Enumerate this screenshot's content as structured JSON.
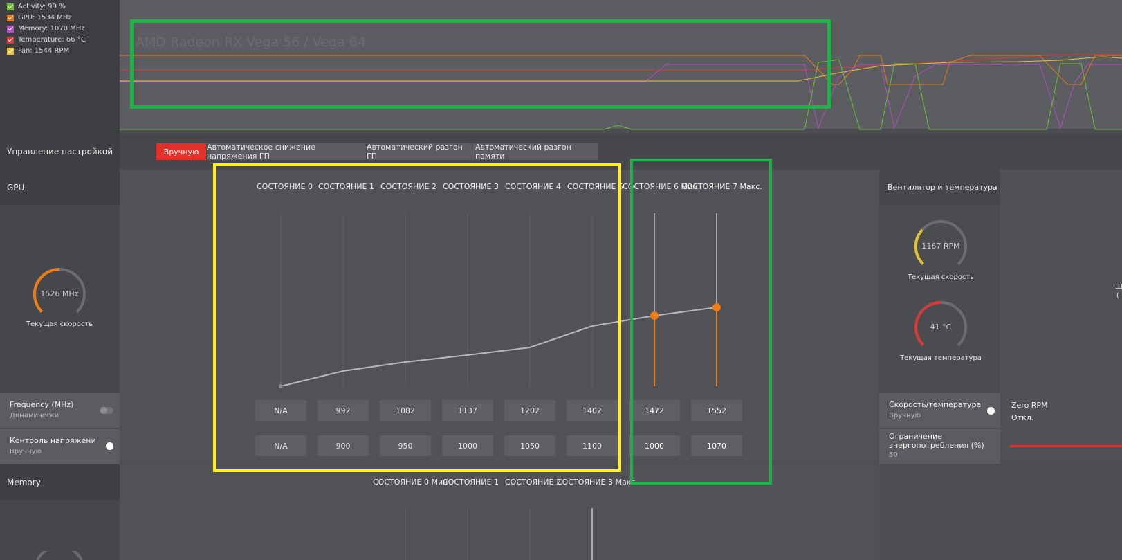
{
  "monitor": {
    "legend": [
      {
        "label": "Activity: 99 %",
        "color": "#6fbf3c"
      },
      {
        "label": "GPU: 1534 MHz",
        "color": "#e07a1f"
      },
      {
        "label": "Memory: 1070 MHz",
        "color": "#b04fc0"
      },
      {
        "label": "Temperature: 66 °C",
        "color": "#d43a3a"
      },
      {
        "label": "Fan: 1544 RPM",
        "color": "#e3c23a"
      }
    ],
    "ghost_title": "AMD Radeon RX Vega 56 / Vega 64"
  },
  "tuning": {
    "label": "Управление настройкой",
    "tabs": [
      "Вручную",
      "Автоматическое снижение напряжения ГП",
      "Автоматический разгон ГП",
      "Автоматический разгон памяти"
    ],
    "active_tab": 0
  },
  "gpu": {
    "label": "GPU",
    "gauge": {
      "value": "1526 MHz",
      "caption": "Текущая скорость"
    },
    "states": [
      "СОСТОЯНИЕ 0",
      "СОСТОЯНИЕ 1",
      "СОСТОЯНИЕ 2",
      "СОСТОЯНИЕ 3",
      "СОСТОЯНИЕ 4",
      "СОСТОЯНИЕ 5",
      "СОСТОЯНИЕ 6 Мин.",
      "СОСТОЯНИЕ 7 Макс."
    ],
    "frequencies": [
      "N/A",
      "992",
      "1082",
      "1137",
      "1202",
      "1402",
      "1472",
      "1552"
    ],
    "voltages": [
      "N/A",
      "900",
      "950",
      "1000",
      "1050",
      "1100",
      "1000",
      "1070"
    ],
    "frequency_toggle": {
      "title": "Frequency (MHz)",
      "sub": "Динамически"
    },
    "voltage_toggle": {
      "title": "Контроль напряжения ...",
      "sub": "Вручную"
    }
  },
  "fan": {
    "label": "Вентилятор и температура",
    "speed": {
      "value": "1167 RPM",
      "caption": "Текущая скорость"
    },
    "temp": {
      "value": "41 °C",
      "caption": "Текущая температура"
    },
    "speed_temp": {
      "title": "Скорость/температура",
      "sub": "Вручную"
    },
    "zero_rpm": {
      "title": "Zero RPM",
      "sub": "Откл."
    },
    "power_limit": {
      "title": "Ограничение энергопотребления (%)",
      "sub": "50"
    }
  },
  "memory": {
    "label": "Memory",
    "states": [
      "СОСТОЯНИЕ 0 Мин",
      "СОСТОЯНИЕ 1",
      "СОСТОЯНИЕ 2",
      "СОСТОЯНИЕ 3 Макс."
    ]
  },
  "colors": {
    "accent": "#e3302a",
    "orange": "#f07c16",
    "yellow_box": "#ffee22",
    "green_box": "#1fb24a"
  }
}
